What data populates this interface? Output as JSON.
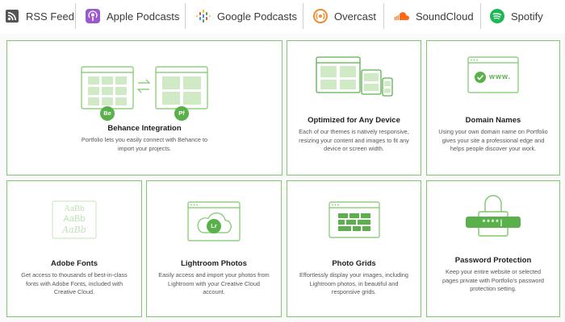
{
  "podcast_bar": {
    "links": [
      {
        "label": "RSS Feed",
        "icon": "rss-icon"
      },
      {
        "label": "Apple Podcasts",
        "icon": "apple-podcasts-icon"
      },
      {
        "label": "Google Podcasts",
        "icon": "google-podcasts-icon"
      },
      {
        "label": "Overcast",
        "icon": "overcast-icon"
      },
      {
        "label": "SoundCloud",
        "icon": "soundcloud-icon"
      },
      {
        "label": "Spotify",
        "icon": "spotify-icon"
      }
    ]
  },
  "features": {
    "behance": {
      "title": "Behance Integration",
      "description": "Portfolio lets you easily connect with Behance to import your projects.",
      "badge_left": "Be",
      "badge_right": "Pf"
    },
    "devices": {
      "title": "Optimized for Any Device",
      "description": "Each of our themes is natively responsive, resizing your content and images to fit any device or screen width."
    },
    "domain": {
      "title": "Domain Names",
      "description": "Using your own domain name on Portfolio gives your site a professional edge and helps people discover your work.",
      "url_text": "www."
    },
    "fonts": {
      "title": "Adobe Fonts",
      "description": "Get access to thousands of best-in-class fonts with Adobe Fonts, included with Creative Cloud.",
      "sample": "AaBb"
    },
    "lightroom": {
      "title": "Lightroom Photos",
      "description": "Easily access and import your photos from Lightroom with your Creative Cloud account.",
      "badge": "Lr"
    },
    "grids": {
      "title": "Photo Grids",
      "description": "Effortlessly display your images, including Lightroom photos, in beautiful and responsive grids."
    },
    "password": {
      "title": "Password Protection",
      "description": "Keep your entire website or selected pages private with Portfolio's password protection setting.",
      "mask": "****|"
    }
  },
  "colors": {
    "accent_green": "#7cc86a",
    "icon_green": "#5ab04a",
    "apple_purple": "#9b59d0",
    "overcast_orange": "#f28a30",
    "soundcloud_orange": "#ff6a16",
    "spotify_green": "#1db954"
  }
}
